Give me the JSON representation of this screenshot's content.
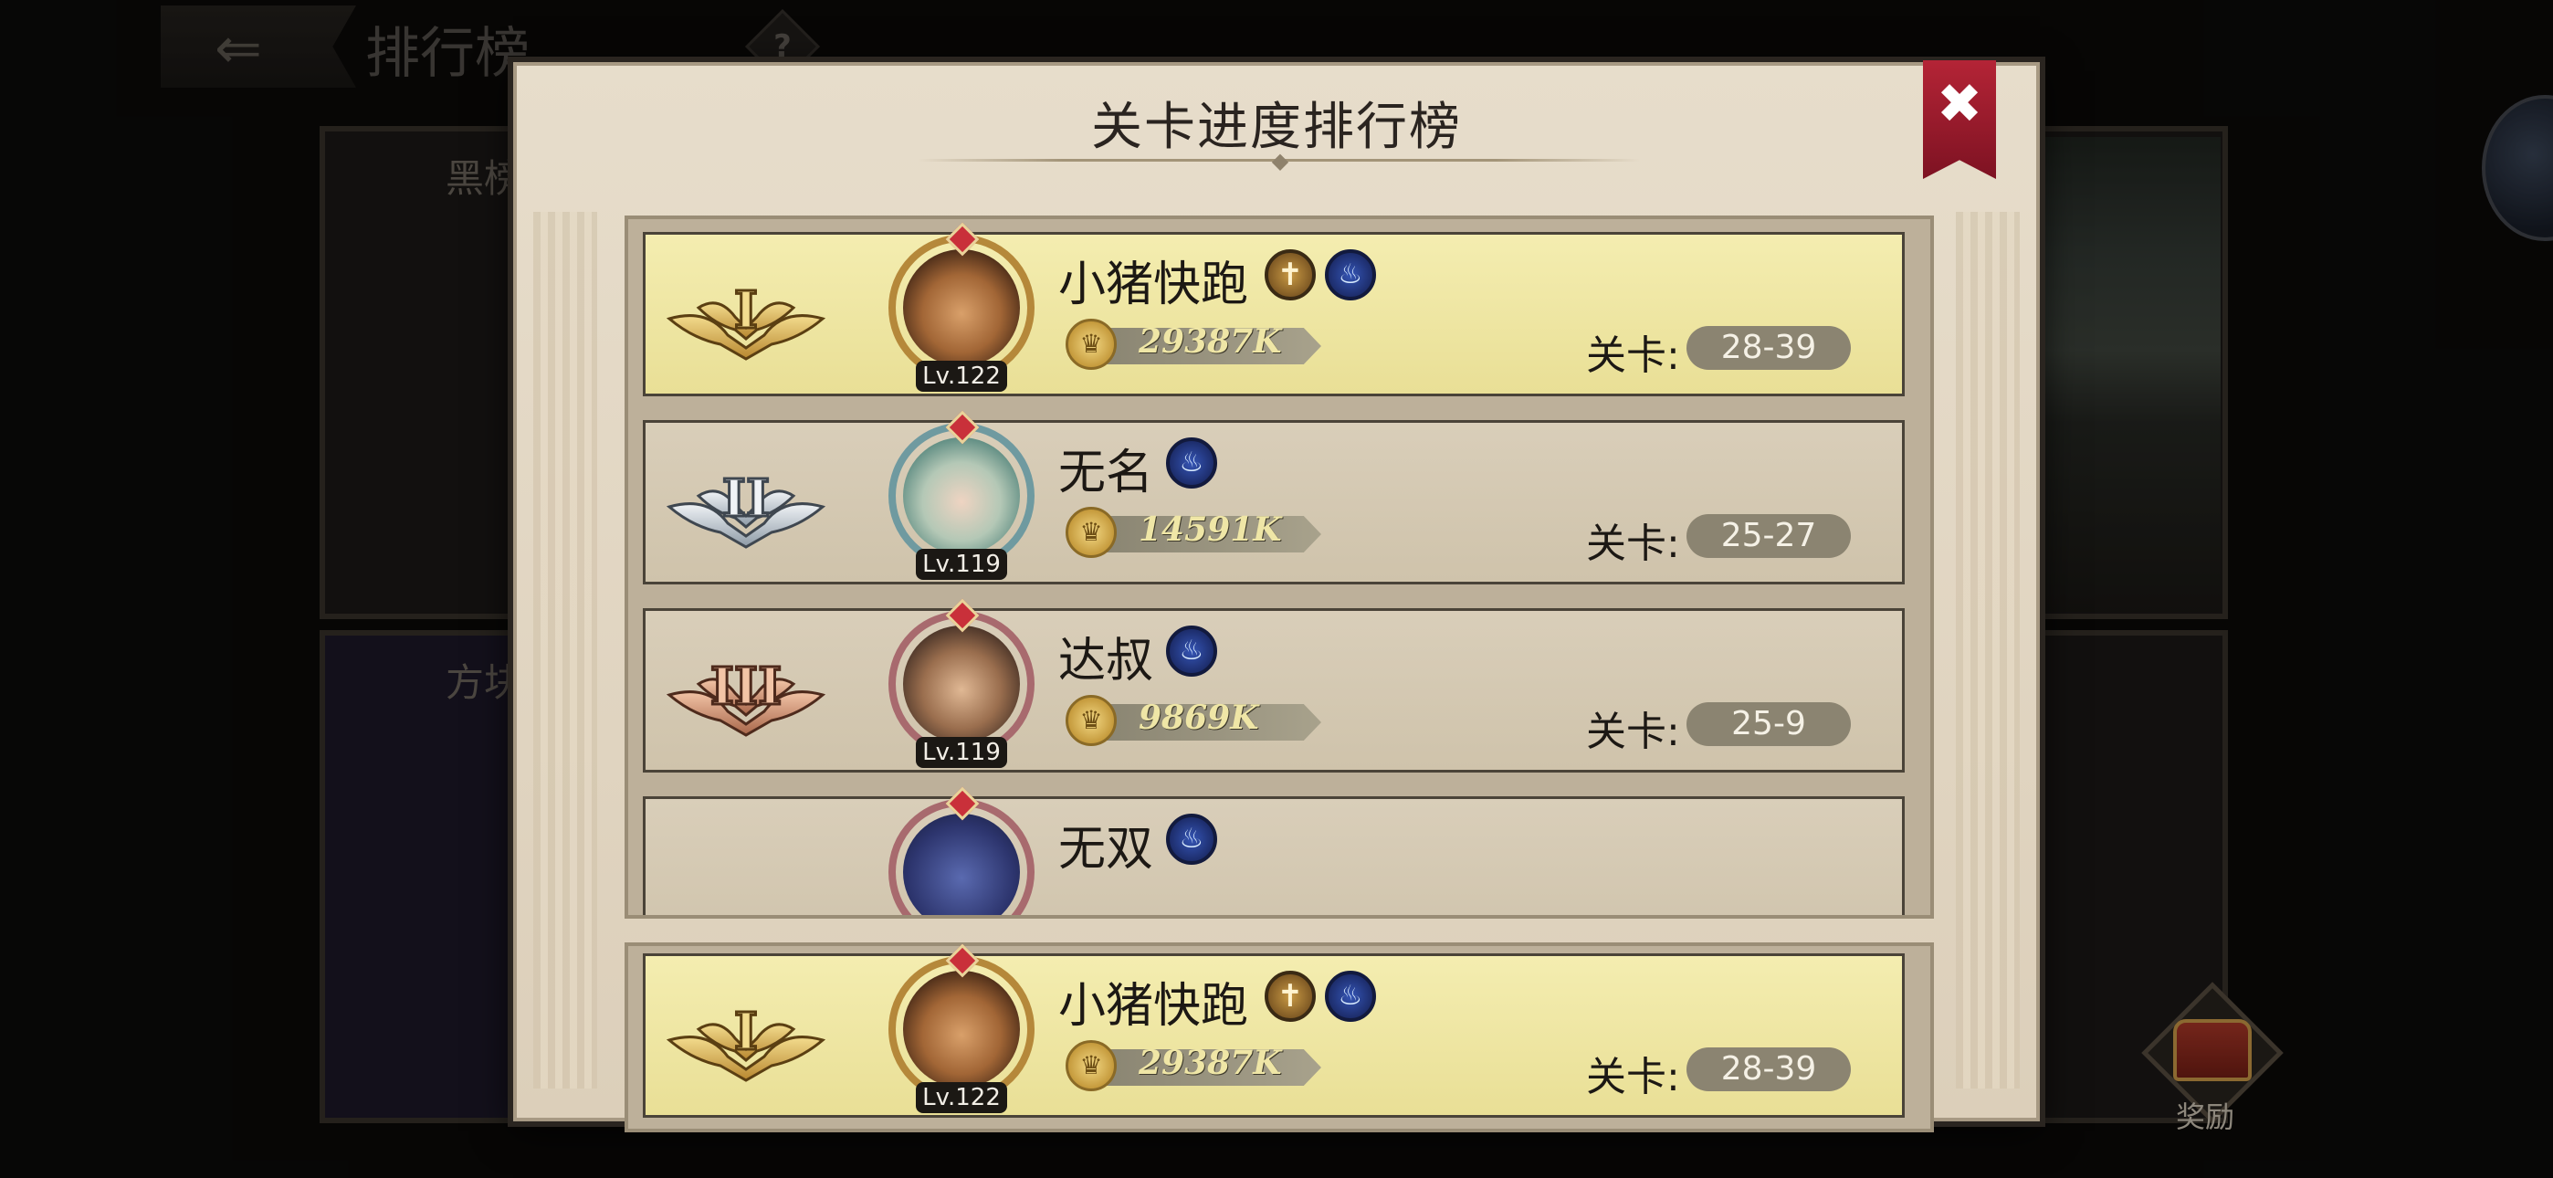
{
  "background": {
    "title": "排行榜",
    "help_label": "?",
    "card1_title": "黑榜",
    "card2_title": "方块",
    "reward_label": "奖励"
  },
  "modal": {
    "title": "关卡进度排行榜",
    "close_label": "✖",
    "stage_prefix": "关卡:"
  },
  "rows": [
    {
      "rank": "I",
      "rank_tier": "gold",
      "name": "小猪快跑",
      "level": "Lv.122",
      "power": "29387K",
      "stage": "28-39",
      "badges": [
        "cross",
        "flame"
      ]
    },
    {
      "rank": "II",
      "rank_tier": "silver",
      "name": "无名",
      "level": "Lv.119",
      "power": "14591K",
      "stage": "25-27",
      "badges": [
        "flame"
      ]
    },
    {
      "rank": "III",
      "rank_tier": "bronze",
      "name": "达叔",
      "level": "Lv.119",
      "power": "9869K",
      "stage": "25-9",
      "badges": [
        "flame"
      ]
    },
    {
      "rank": "",
      "rank_tier": "plain",
      "name": "无双",
      "level": "",
      "power": "",
      "stage": "",
      "badges": [
        "flame"
      ]
    }
  ],
  "self_row": {
    "rank": "I",
    "rank_tier": "gold",
    "name": "小猪快跑",
    "level": "Lv.122",
    "power": "29387K",
    "stage": "28-39",
    "badges": [
      "cross",
      "flame"
    ]
  },
  "icons": {
    "back": "back-arrow-icon",
    "close": "close-icon",
    "cross_badge": "cross-badge-icon",
    "flame_badge": "flame-badge-icon",
    "power": "lion-power-icon",
    "reward": "treasure-chest-icon"
  },
  "colors": {
    "gold_row": "#f4edb0",
    "plain_row": "#d9ceb9",
    "close_ribbon": "#b42436",
    "stage_pill": "#8b8471"
  }
}
